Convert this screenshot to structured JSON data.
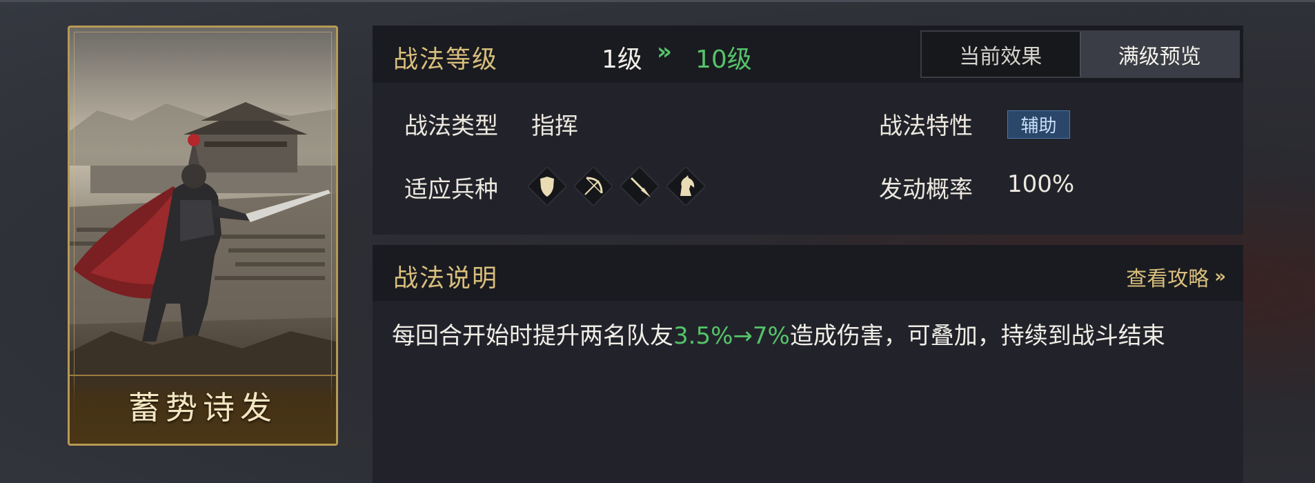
{
  "card": {
    "name": "蓄势诗发",
    "art": "armored-general-overlooking-army-and-fortress"
  },
  "level_panel": {
    "title": "战法等级",
    "level_from": "1级",
    "level_arrow": "»",
    "level_to": "10级",
    "tabs": [
      {
        "label": "当前效果",
        "active": false
      },
      {
        "label": "满级预览",
        "active": true
      }
    ]
  },
  "attributes": {
    "type_label": "战法类型",
    "type_value": "指挥",
    "trait_label": "战法特性",
    "trait_value": "辅助",
    "units_label": "适应兵种",
    "unit_icons": [
      "shield-icon",
      "bow-icon",
      "spear-icon",
      "horse-icon"
    ],
    "rate_label": "发动概率",
    "rate_value": "100%"
  },
  "description": {
    "title": "战法说明",
    "guide_link": "查看攻略",
    "guide_chevron": "»",
    "text_before": "每回合开始时提升两名队友",
    "highlight": "3.5%→7%",
    "text_after": "造成伤害，可叠加，持续到战斗结束"
  },
  "colors": {
    "gold": "#d9bf7d",
    "green_highlight": "#55c36a",
    "tag_blue": "#2a4669",
    "panel_bg": "#22232a",
    "header_bg": "#1a1b20"
  }
}
